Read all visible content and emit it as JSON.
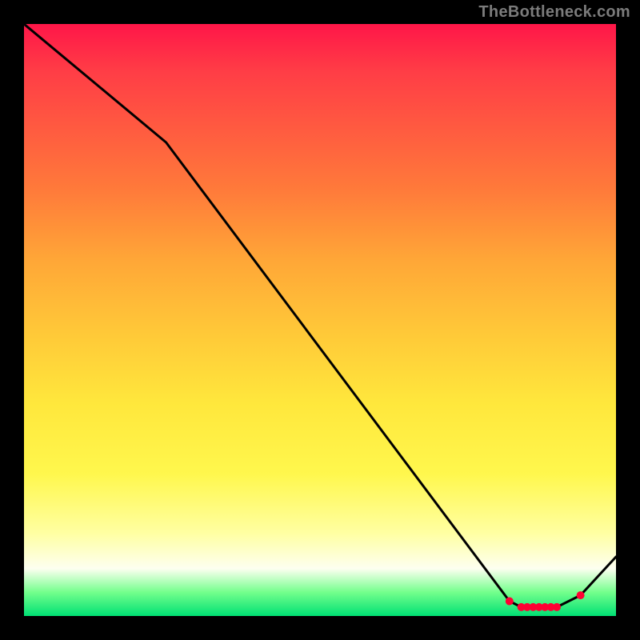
{
  "watermark": "TheBottleneck.com",
  "chart_data": {
    "type": "line",
    "title": "",
    "xlabel": "",
    "ylabel": "",
    "xlim": [
      0,
      100
    ],
    "ylim": [
      0,
      100
    ],
    "series": [
      {
        "name": "curve",
        "x": [
          0,
          24,
          82,
          84,
          85,
          86,
          87,
          88,
          89,
          90,
          94,
          100
        ],
        "values": [
          100,
          80,
          2.5,
          1.5,
          1.5,
          1.5,
          1.5,
          1.5,
          1.5,
          1.5,
          3.5,
          10
        ]
      }
    ],
    "markers": {
      "x": [
        82,
        84,
        85,
        86,
        87,
        88,
        89,
        90,
        94
      ],
      "values": [
        2.5,
        1.5,
        1.5,
        1.5,
        1.5,
        1.5,
        1.5,
        1.5,
        3.5
      ],
      "color": "#ff0033"
    }
  },
  "colors": {
    "background": "#000000",
    "curve": "#000000",
    "marker": "#ff0033",
    "watermark": "#7b7b7b"
  }
}
